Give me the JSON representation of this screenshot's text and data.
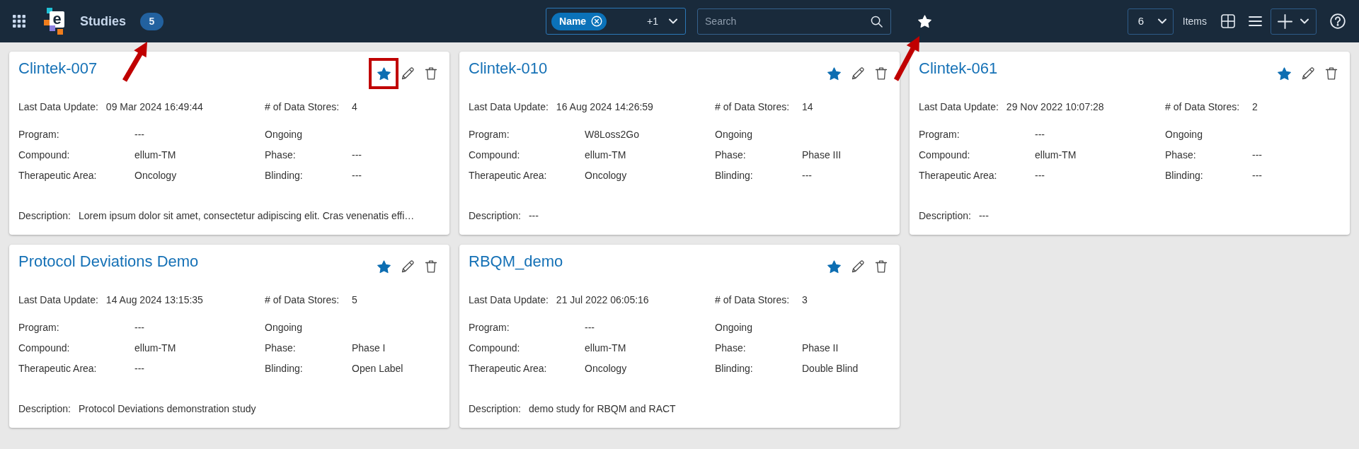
{
  "header": {
    "logo_letter": "e",
    "title": "Studies",
    "count": "5",
    "filter": {
      "chips": [
        {
          "label": "Name"
        }
      ],
      "more": "+1"
    },
    "search": {
      "placeholder": "Search"
    },
    "page_size": "6",
    "page_size_label": "Items"
  },
  "studies": [
    {
      "title": "Clintek-007",
      "favorite": true,
      "highlighted": true,
      "last_update": {
        "label": "Last Data Update:",
        "value": "09 Mar 2024 16:49:44"
      },
      "data_stores": {
        "label": "# of Data Stores:",
        "value": "4"
      },
      "details": [
        {
          "kind": "field",
          "label": "Program:",
          "value": "---"
        },
        {
          "kind": "status",
          "value": "Ongoing"
        },
        {
          "kind": "field",
          "label": "Compound:",
          "value": "ellum-TM"
        },
        {
          "kind": "field",
          "label": "Phase:",
          "value": "---"
        },
        {
          "kind": "field",
          "label": "Therapeutic Area:",
          "value": "Oncology"
        },
        {
          "kind": "field",
          "label": "Blinding:",
          "value": "---"
        }
      ],
      "description": {
        "label": "Description:",
        "value": "Lorem ipsum dolor sit amet, consectetur adipiscing elit. Cras venenatis effi…"
      }
    },
    {
      "title": "Clintek-010",
      "favorite": true,
      "highlighted": false,
      "last_update": {
        "label": "Last Data Update:",
        "value": "16 Aug 2024 14:26:59"
      },
      "data_stores": {
        "label": "# of Data Stores:",
        "value": "14"
      },
      "details": [
        {
          "kind": "field",
          "label": "Program:",
          "value": "W8Loss2Go"
        },
        {
          "kind": "status",
          "value": "Ongoing"
        },
        {
          "kind": "field",
          "label": "Compound:",
          "value": "ellum-TM"
        },
        {
          "kind": "field",
          "label": "Phase:",
          "value": "Phase III"
        },
        {
          "kind": "field",
          "label": "Therapeutic Area:",
          "value": "Oncology"
        },
        {
          "kind": "field",
          "label": "Blinding:",
          "value": "---"
        }
      ],
      "description": {
        "label": "Description:",
        "value": "---"
      }
    },
    {
      "title": "Clintek-061",
      "favorite": true,
      "highlighted": false,
      "last_update": {
        "label": "Last Data Update:",
        "value": "29 Nov 2022 10:07:28"
      },
      "data_stores": {
        "label": "# of Data Stores:",
        "value": "2"
      },
      "details": [
        {
          "kind": "field",
          "label": "Program:",
          "value": "---"
        },
        {
          "kind": "status",
          "value": "Ongoing"
        },
        {
          "kind": "field",
          "label": "Compound:",
          "value": "ellum-TM"
        },
        {
          "kind": "field",
          "label": "Phase:",
          "value": "---"
        },
        {
          "kind": "field",
          "label": "Therapeutic Area:",
          "value": "---"
        },
        {
          "kind": "field",
          "label": "Blinding:",
          "value": "---"
        }
      ],
      "description": {
        "label": "Description:",
        "value": "---"
      }
    },
    {
      "title": "Protocol Deviations Demo",
      "favorite": true,
      "highlighted": false,
      "last_update": {
        "label": "Last Data Update:",
        "value": "14 Aug 2024 13:15:35"
      },
      "data_stores": {
        "label": "# of Data Stores:",
        "value": "5"
      },
      "details": [
        {
          "kind": "field",
          "label": "Program:",
          "value": "---"
        },
        {
          "kind": "status",
          "value": "Ongoing"
        },
        {
          "kind": "field",
          "label": "Compound:",
          "value": "ellum-TM"
        },
        {
          "kind": "field",
          "label": "Phase:",
          "value": "Phase I"
        },
        {
          "kind": "field",
          "label": "Therapeutic Area:",
          "value": "---"
        },
        {
          "kind": "field",
          "label": "Blinding:",
          "value": "Open Label"
        }
      ],
      "description": {
        "label": "Description:",
        "value": "Protocol Deviations demonstration study"
      }
    },
    {
      "title": "RBQM_demo",
      "favorite": true,
      "highlighted": false,
      "last_update": {
        "label": "Last Data Update:",
        "value": "21 Jul 2022 06:05:16"
      },
      "data_stores": {
        "label": "# of Data Stores:",
        "value": "3"
      },
      "details": [
        {
          "kind": "field",
          "label": "Program:",
          "value": "---"
        },
        {
          "kind": "status",
          "value": "Ongoing"
        },
        {
          "kind": "field",
          "label": "Compound:",
          "value": "ellum-TM"
        },
        {
          "kind": "field",
          "label": "Phase:",
          "value": "Phase II"
        },
        {
          "kind": "field",
          "label": "Therapeutic Area:",
          "value": "Oncology"
        },
        {
          "kind": "field",
          "label": "Blinding:",
          "value": "Double Blind"
        }
      ],
      "description": {
        "label": "Description:",
        "value": "demo study for RBQM and RACT"
      }
    }
  ]
}
